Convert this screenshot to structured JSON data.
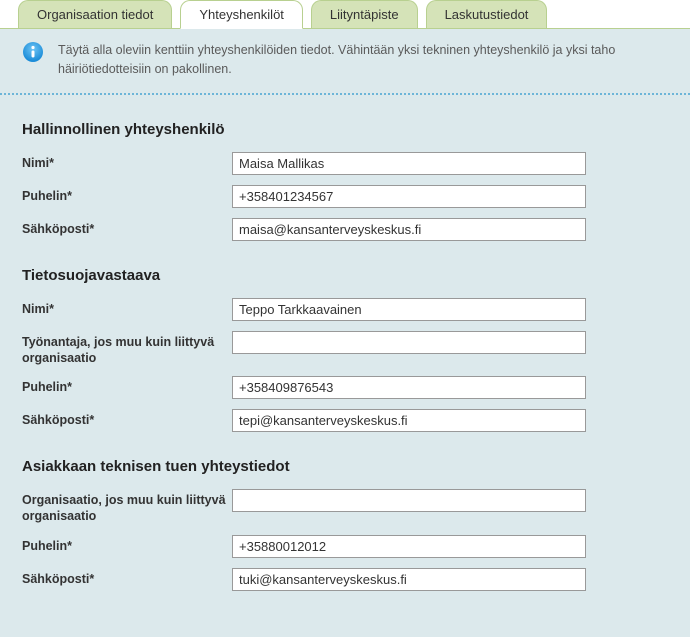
{
  "tabs": {
    "org": "Organisaation tiedot",
    "contacts": "Yhteyshenkilöt",
    "accesspoint": "Liityntäpiste",
    "billing": "Laskutustiedot"
  },
  "info": {
    "text": "Täytä alla oleviin kenttiin yhteyshenkilöiden tiedot. Vähintään yksi tekninen yhteyshenkilö ja yksi taho häiriötiedotteisiin on pakollinen."
  },
  "sections": {
    "admin": {
      "title": "Hallinnollinen yhteyshenkilö",
      "name_label": "Nimi*",
      "name_value": "Maisa Mallikas",
      "phone_label": "Puhelin*",
      "phone_value": "+358401234567",
      "email_label": "Sähköposti*",
      "email_value": "maisa@kansanterveyskeskus.fi"
    },
    "dpo": {
      "title": "Tietosuojavastaava",
      "name_label": "Nimi*",
      "name_value": "Teppo Tarkkaavainen",
      "employer_label": "Työnantaja, jos muu kuin liittyvä organisaatio",
      "employer_value": "",
      "phone_label": "Puhelin*",
      "phone_value": "+358409876543",
      "email_label": "Sähköposti*",
      "email_value": "tepi@kansanterveyskeskus.fi"
    },
    "support": {
      "title": "Asiakkaan teknisen tuen yhteystiedot",
      "org_label": "Organisaatio, jos muu kuin liittyvä organisaatio",
      "org_value": "",
      "phone_label": "Puhelin*",
      "phone_value": "+35880012012",
      "email_label": "Sähköposti*",
      "email_value": "tuki@kansanterveyskeskus.fi"
    }
  }
}
